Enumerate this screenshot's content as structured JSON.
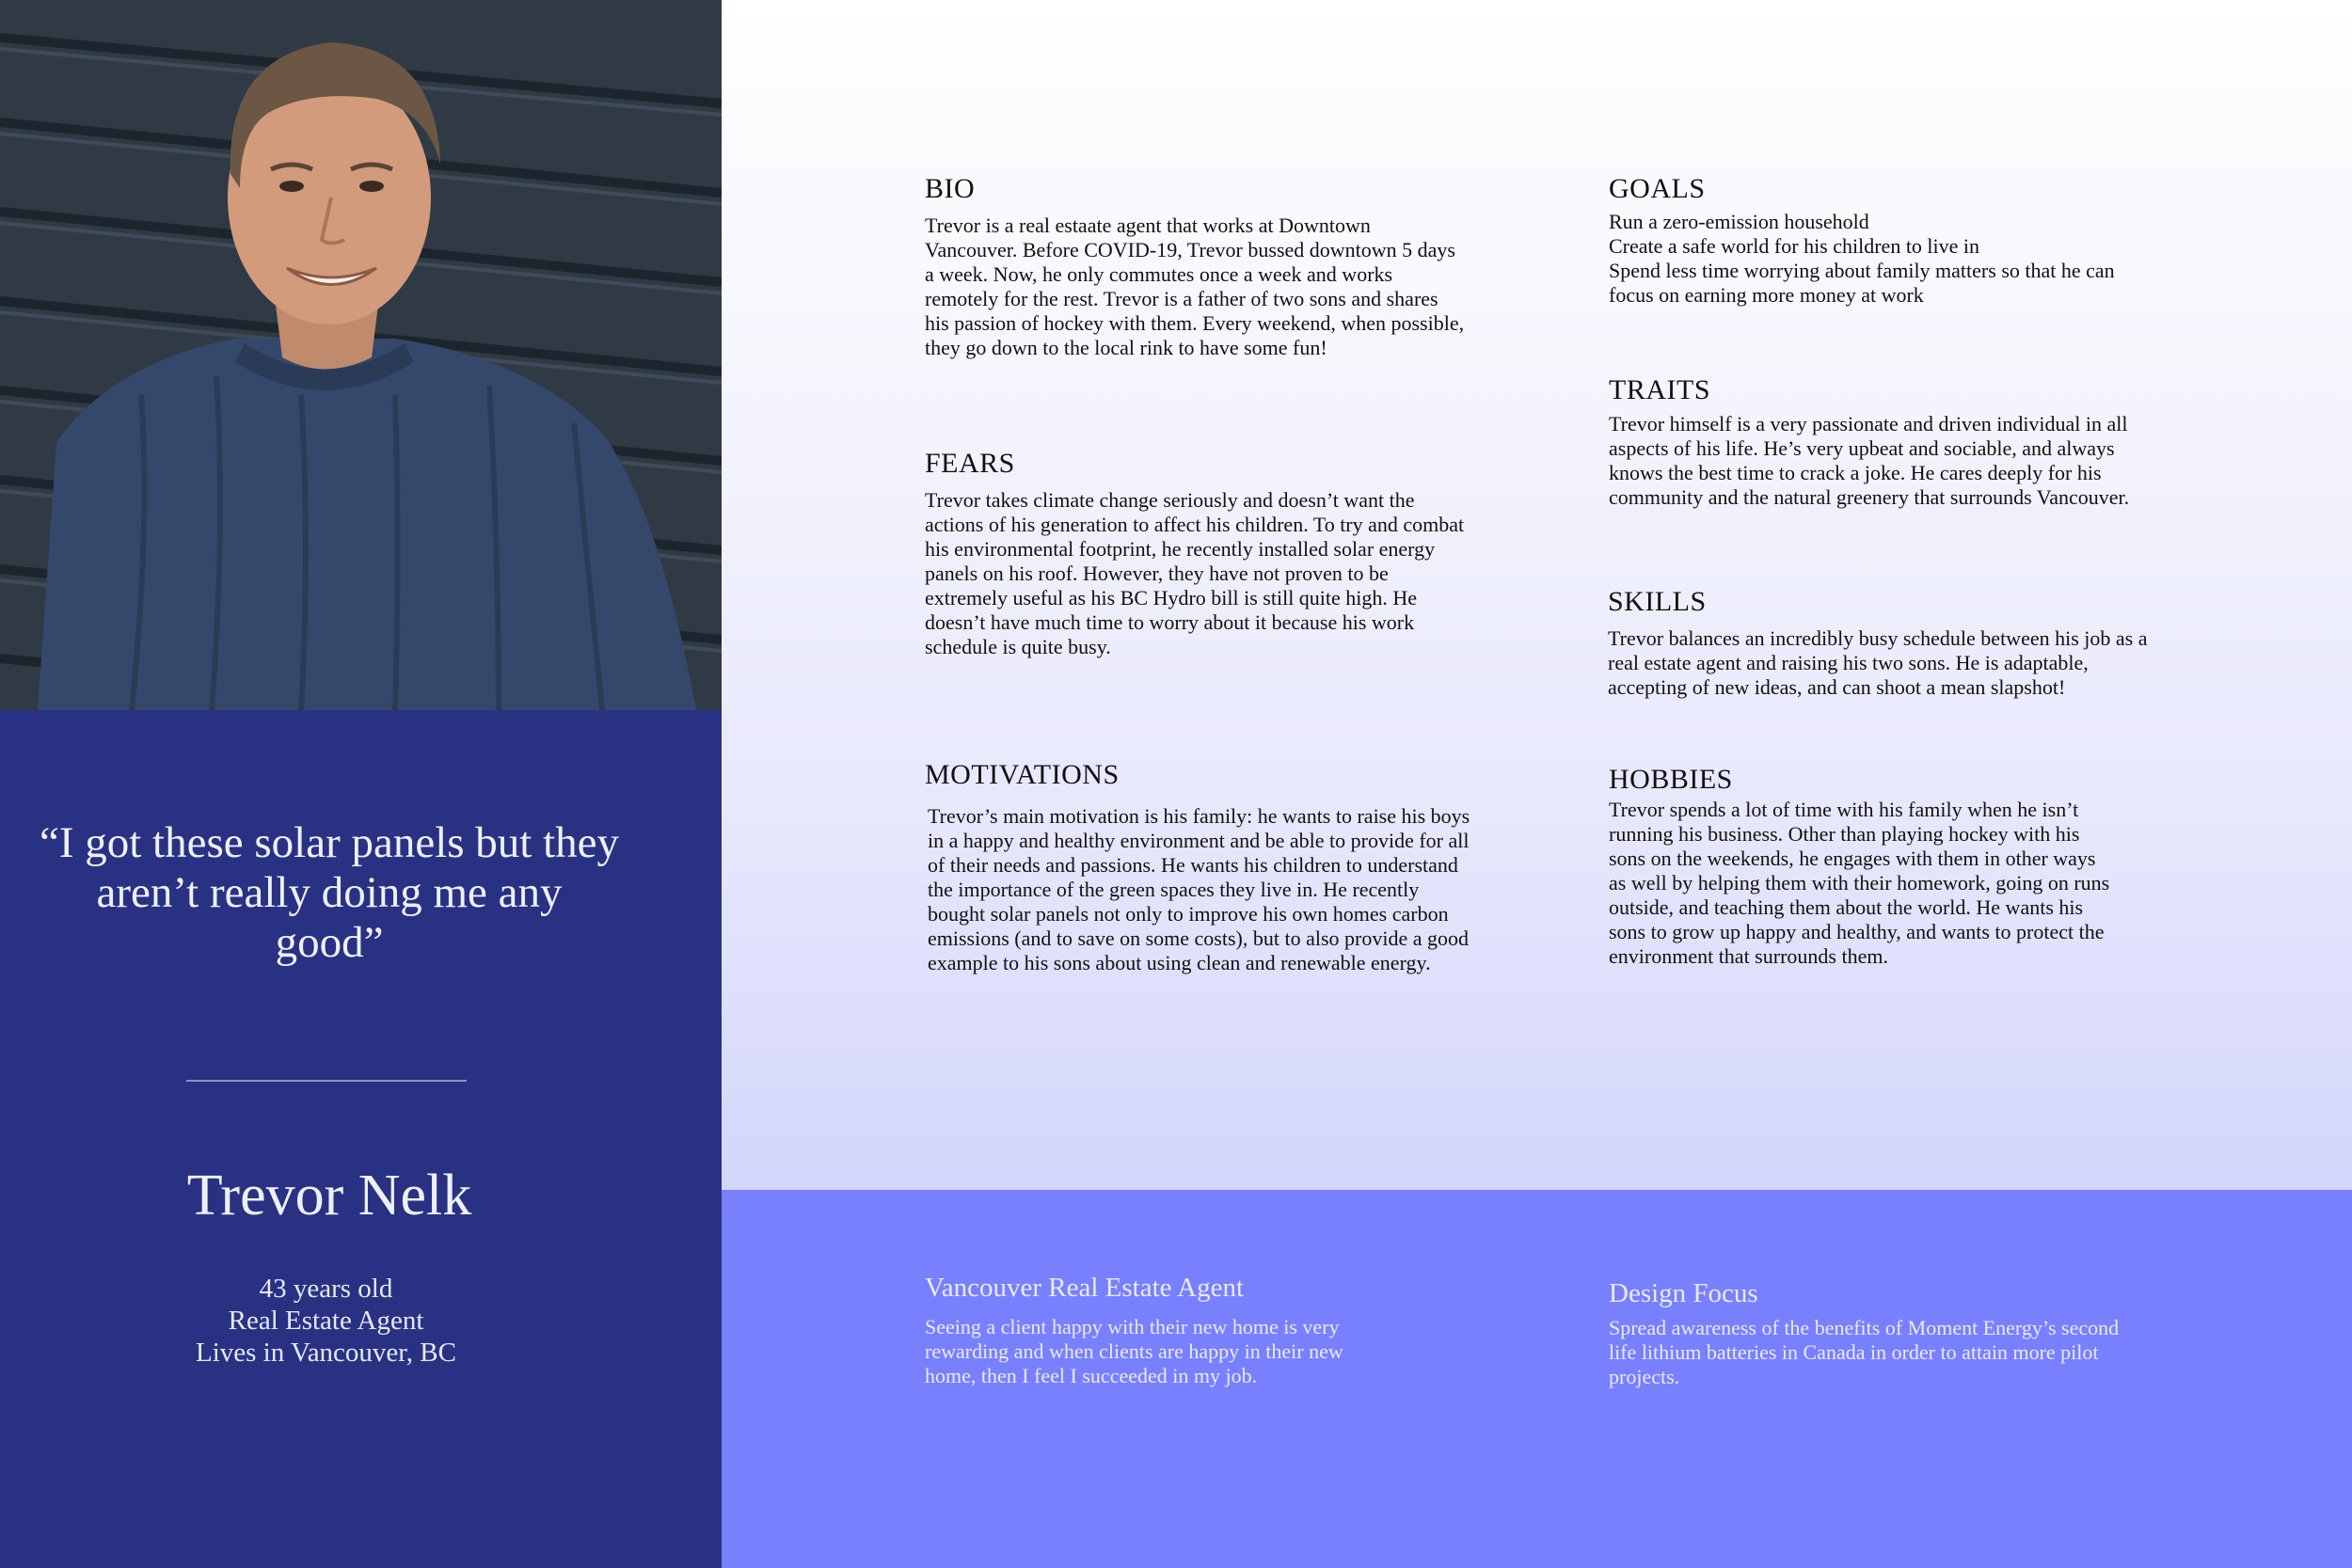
{
  "persona": {
    "quote": "“I got these solar panels but they aren’t really doing me any good”",
    "name": "Trevor Nelk",
    "age": "43 years old",
    "occupation": "Real Estate Agent",
    "location": "Lives in Vancouver, BC"
  },
  "sections": {
    "bio": {
      "title": "BIO",
      "text": "Trevor is a real estaate agent that works at Downtown\nVancouver. Before COVID-19, Trevor bussed downtown 5 days\na week. Now, he only commutes once a week and works\nremotely for the rest. Trevor is a father of two sons and shares\nhis passion of hockey with them. Every weekend, when possible,\nthey go down to the local rink to have some fun!"
    },
    "goals": {
      "title": "GOALS",
      "text": "Run a zero-emission household\nCreate a safe world for his children to live in\nSpend less time worrying about family matters so that he can\nfocus on earning more money at work"
    },
    "traits": {
      "title": "TRAITS",
      "text": "Trevor himself is a very passionate and driven individual in all\naspects of his life. He’s very upbeat and sociable,  and always\nknows the best time to crack a joke. He cares deeply for his\ncommunity and the natural greenery that surrounds Vancouver."
    },
    "fears": {
      "title": "FEARS",
      "text": "Trevor takes climate change seriously and doesn’t want the\nactions of his generation to affect his children. To try and combat\nhis environmental footprint, he recently installed solar energy\npanels on his roof. However, they have not proven to be\nextremely useful as his BC Hydro bill is still quite high. He\ndoesn’t have much time to worry about it because his work\nschedule is quite busy."
    },
    "skills": {
      "title": "SKILLS",
      "text": "Trevor balances an incredibly busy schedule between his job as a\nreal estate agent and raising his two sons. He is adaptable,\naccepting of new ideas, and can shoot a mean slapshot!"
    },
    "motivations": {
      "title": "MOTIVATIONS",
      "text": "Trevor’s main motivation is his family: he wants to raise his boys\nin a happy and healthy environment and be able to provide for all\nof their needs and passions. He wants his children to understand\nthe importance of the green spaces they live in. He recently\nbought solar panels not only to improve his own homes carbon\nemissions (and to save on some costs), but to also provide a good\nexample to his sons about using clean and renewable energy."
    },
    "hobbies": {
      "title": "HOBBIES",
      "text": "Trevor spends a lot of time with his family when he isn’t\nrunning his business. Other than playing hockey with his\nsons on the weekends, he engages with them in other ways\nas well by helping them with their homework, going on runs\noutside, and teaching them about the world. He wants his\nsons to grow up happy and healthy, and wants to protect the\nenvironment that surrounds them."
    }
  },
  "band": {
    "role": {
      "title": "Vancouver Real Estate Agent",
      "text": "Seeing a client happy with their new home is very\nrewarding and when clients are happy in their new\nhome, then I feel I succeeded in my job."
    },
    "design_focus": {
      "title": "Design Focus",
      "text": "Spread awareness of the benefits of Moment Energy’s second\nlife lithium batteries in Canada in order to attain more pilot\nprojects."
    }
  },
  "colors": {
    "left_panel": "#293282",
    "bottom_band": "#7880fd",
    "panel_text": "#eef0ff"
  },
  "photo_icon": "person-portrait-image"
}
